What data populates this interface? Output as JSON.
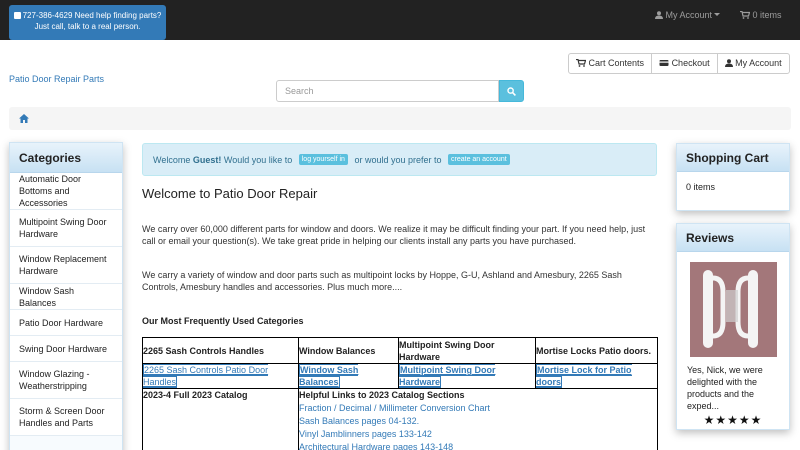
{
  "topbar": {
    "phone_line": "727-386-4629 Need help finding parts?",
    "phone_sub": "Just call, talk to a real person.",
    "account_label": "My Account",
    "items_label": "0 items"
  },
  "buttons": {
    "cart_contents": "Cart Contents",
    "checkout": "Checkout",
    "my_account": "My Account"
  },
  "site_name": "Patio Door Repair Parts",
  "search": {
    "placeholder": "Search"
  },
  "sidebar": {
    "categories_title": "Categories",
    "items": [
      "Automatic Door Bottoms and Accessories",
      "Multipoint Swing Door Hardware",
      "Window Replacement Hardware",
      "Window Sash Balances",
      "Patio Door Hardware",
      "Swing Door Hardware",
      "Window Glazing - Weatherstripping",
      "Storm & Screen Door Handles and Parts"
    ]
  },
  "alert": {
    "welcome": "Welcome ",
    "guest": "Guest!",
    "question": " Would you like to ",
    "login": "log yourself in",
    "or": " or would you prefer to ",
    "create": "create an account"
  },
  "main": {
    "title": "Welcome to Patio Door Repair",
    "para1": "We carry over 60,000 different parts for window and doors. We realize it may be difficult finding your part. If you need help, just call or email your question(s). We take great pride in helping our clients install any parts you have purchased.",
    "para2": "We carry a variety of window and door parts such as multipoint locks by Hoppe, G-U, Ashland and Amesbury, 2265 Sash Controls, Amesbury handles and accessories. Plus much more....",
    "freq_title": "Our Most Frequently Used Categories"
  },
  "table": {
    "headers": [
      "2265 Sash Controls Handles",
      "Window Balances",
      "Multipoint Swing Door Hardware",
      "Mortise Locks Patio doors."
    ],
    "links": [
      "2265 Sash Controls Patio Door Handles",
      "Window Sash Balances",
      "Multipoint Swing Door Hardware",
      "Mortise Lock for Patio doors"
    ],
    "catalog_title": "2023-4 Full 2023 Catalog",
    "helpful_title": "Helpful Links to 2023 Catalog Sections",
    "helpful_links": [
      "Fraction / Decimal / Millimeter Conversion Chart",
      "Sash Balances pages 04-132.",
      "Vinyl Jamblinners pages 133-142",
      "Architectural Hardware pages 143-148"
    ]
  },
  "cart": {
    "title": "Shopping Cart",
    "items": "0 items"
  },
  "reviews": {
    "title": "Reviews",
    "text": "Yes, Nick, we were delighted with the products and the exped...",
    "stars": "★★★★★"
  }
}
